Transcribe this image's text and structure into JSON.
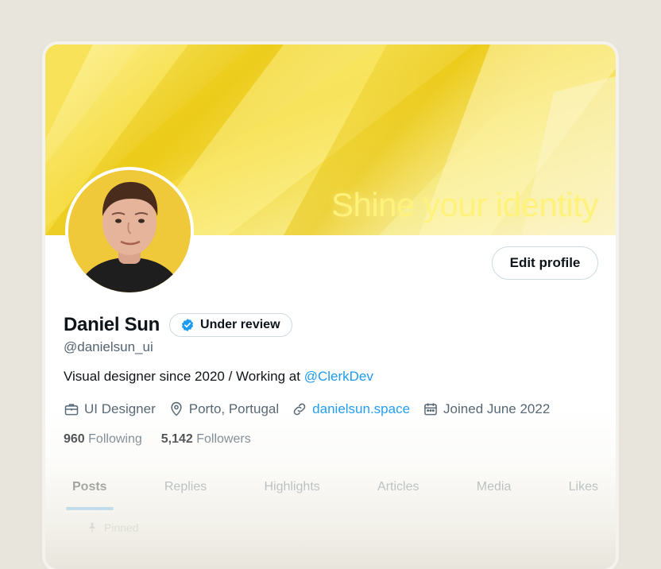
{
  "banner": {
    "text": "Shine your identity"
  },
  "profile": {
    "name": "Daniel Sun",
    "badge_label": "Under review",
    "handle": "@danielsun_ui",
    "bio_text": "Visual designer since 2020 / Working at ",
    "bio_mention": "@ClerkDev",
    "edit_label": "Edit profile"
  },
  "meta": {
    "role": "UI Designer",
    "location": "Porto, Portugal",
    "website": "danielsun.space",
    "joined": "Joined June 2022"
  },
  "stats": {
    "following_count": "960",
    "following_label": "Following",
    "followers_count": "5,142",
    "followers_label": "Followers"
  },
  "tabs": [
    "Posts",
    "Replies",
    "Highlights",
    "Articles",
    "Media",
    "Likes"
  ],
  "pinned": {
    "label": "Pinned"
  },
  "colors": {
    "accent": "#1d9bf0",
    "banner": "#f3d62a",
    "text": "#0f1419",
    "muted": "#536471"
  },
  "icons": {
    "verified": "verified-badge-icon",
    "role": "briefcase-icon",
    "location": "location-pin-icon",
    "website": "link-icon",
    "joined": "calendar-icon"
  }
}
